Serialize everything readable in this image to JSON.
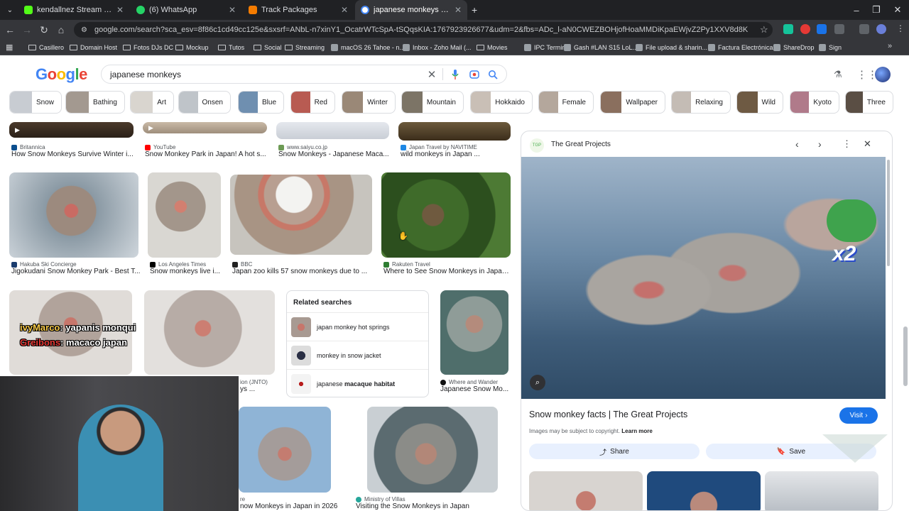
{
  "browser": {
    "tabs": [
      {
        "title": "kendallnez Stream - Kick D",
        "color": "#53fc18"
      },
      {
        "title": "(6) WhatsApp",
        "color": "#25d366"
      },
      {
        "title": "Track Packages",
        "color": "#f57c00"
      },
      {
        "title": "japanese monkeys - Google Se",
        "color": "#4285f4"
      }
    ],
    "url": "google.com/search?sca_esv=8f86c1cd49cc125e&sxsrf=ANbL-n7xinY1_OcatrWTcSpA-tSQqsKIA:1767923926677&udm=2&fbs=ADc_l-aN0CWEZBOHjofHoaMMDiKpaEWjvZ2Py1XXV8d8KvlI3vWUtYx0DZdicpfE1faGYenqWn-q4...",
    "bookmarks": [
      "Casillero",
      "Domain Host",
      "Fotos DJs DC",
      "Mockup",
      "Tutos",
      "Social",
      "Streaming",
      "macOS 26 Tahoe - n...",
      "Inbox - Zoho Mail (...",
      "Movies",
      "IPC Terminal",
      "Gash #LAN S15 LoL...",
      "File upload & sharin...",
      "Factura Electrónica",
      "ShareDrop",
      "Sign"
    ]
  },
  "google": {
    "logo": "Google",
    "query": "japanese monkeys",
    "chips": [
      "Snow",
      "Bathing",
      "Art",
      "Onsen",
      "Blue",
      "Red",
      "Winter",
      "Mountain",
      "Hokkaido",
      "Female",
      "Wallpaper",
      "Relaxing",
      "Wild",
      "Kyoto",
      "Three"
    ]
  },
  "results": {
    "row1": [
      {
        "source": "Britannica",
        "caption": "How Snow Monkeys Survive Winter i..."
      },
      {
        "source": "YouTube",
        "caption": "Snow Monkey Park in Japan! A hot s..."
      },
      {
        "source": "www.saiyu.co.jp",
        "caption": "Snow Monkeys - Japanese Maca..."
      },
      {
        "source": "Japan Travel by NAVITIME",
        "caption": "wild monkeys in Japan ..."
      }
    ],
    "row2": [
      {
        "source": "Hakuba Ski Concierge",
        "caption": "Jigokudani Snow Monkey Park - Best T..."
      },
      {
        "source": "Los Angeles Times",
        "caption": "Snow monkeys live i..."
      },
      {
        "source": "BBC",
        "caption": "Japan zoo kills 57 snow monkeys due to ..."
      },
      {
        "source": "Rakuten Travel",
        "caption": "Where to See Snow Monkeys in Japan ..."
      }
    ],
    "row3": [
      {
        "source": "ion (JNTO)",
        "caption": "ys ..."
      },
      {
        "source": "Where and Wander",
        "caption": "Japanese Snow Mo..."
      }
    ],
    "row4": [
      {
        "source": "re",
        "caption": "now Monkeys in Japan in 2026"
      },
      {
        "source": "Ministry of Villas",
        "caption": "Visiting the Snow Monkeys in Japan"
      }
    ]
  },
  "related": {
    "heading": "Related searches",
    "items": [
      {
        "plain": "japan monkey hot springs",
        "bold": ""
      },
      {
        "plain": "monkey in snow jacket",
        "bold": ""
      },
      {
        "plain": "japanese ",
        "bold": "macaque habitat"
      }
    ]
  },
  "panel": {
    "source": "The Great Projects",
    "badge": "TGP",
    "title": "Snow monkey facts | The Great Projects",
    "visit": "Visit",
    "copyright": "Images may be subject to copyright.",
    "learn_more": "Learn more",
    "share": "Share",
    "save": "Save",
    "overlay": "x2"
  },
  "stream": {
    "chat": [
      {
        "user": "ivyMarco",
        "msg": ": yapanis monqui",
        "color": "#f7c948"
      },
      {
        "user": "Greibons",
        "msg": ": macaco japan",
        "color": "#e53935"
      }
    ]
  }
}
